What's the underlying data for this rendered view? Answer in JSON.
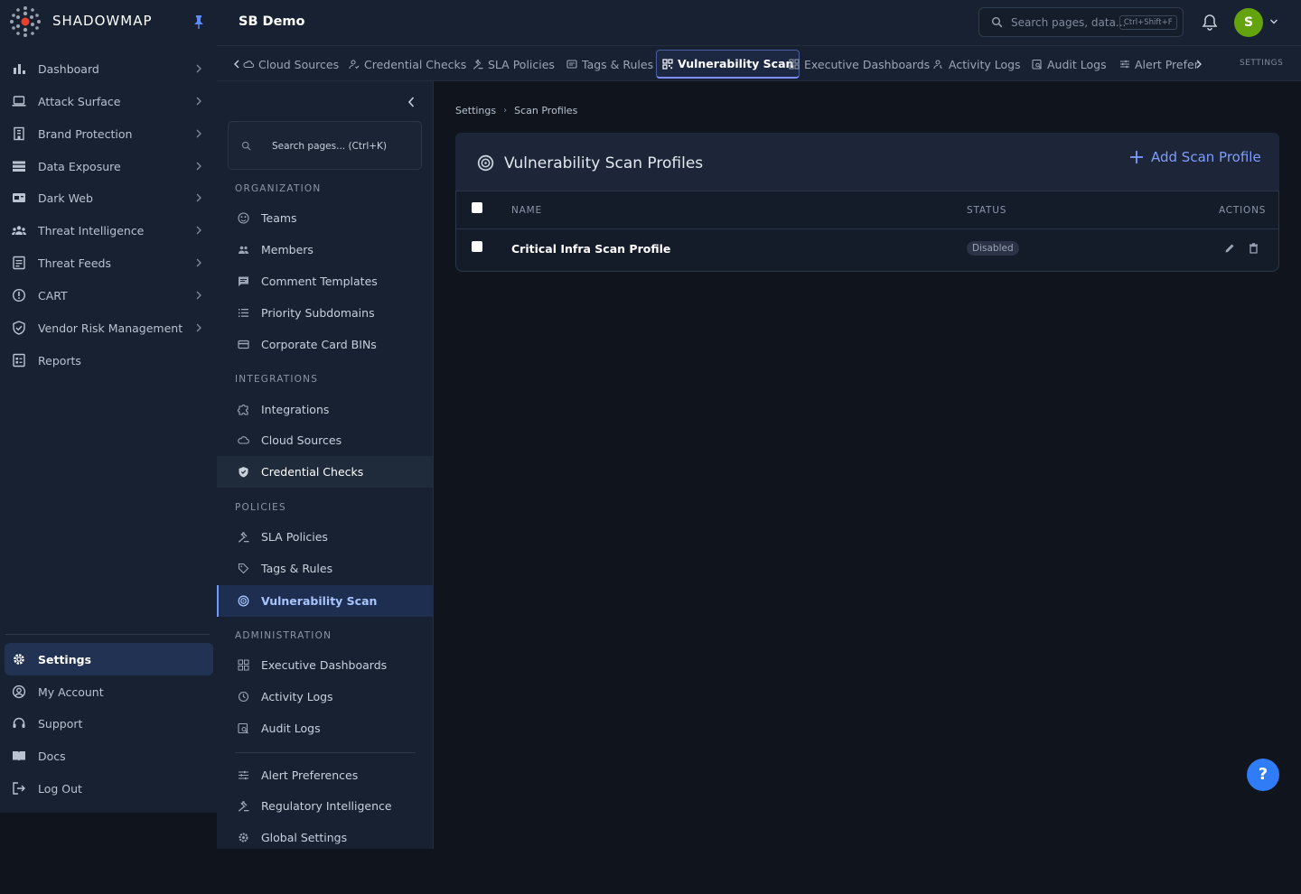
{
  "app": {
    "brand": "SHADOWMAP",
    "page_title": "SB Demo"
  },
  "colors": {
    "accent": "#7f9cff",
    "active_nav": "#223252",
    "avatar": "#64a30d",
    "help": "#2f7cf6",
    "logo_dot": "#e8402b"
  },
  "sidebar": {
    "items": [
      {
        "label": "Dashboard",
        "icon": "bar-chart-icon"
      },
      {
        "label": "Attack Surface",
        "icon": "laptop-icon"
      },
      {
        "label": "Brand Protection",
        "icon": "building-icon"
      },
      {
        "label": "Data Exposure",
        "icon": "database-icon"
      },
      {
        "label": "Dark Web",
        "icon": "dark-web-icon"
      },
      {
        "label": "Threat Intelligence",
        "icon": "people-group-icon"
      },
      {
        "label": "Threat Feeds",
        "icon": "feed-document-icon"
      },
      {
        "label": "CART",
        "icon": "info-circle-icon"
      },
      {
        "label": "Vendor Risk Management",
        "icon": "shield-check-icon"
      },
      {
        "label": "Reports",
        "icon": "report-icon"
      }
    ],
    "bottom": [
      {
        "label": "Settings",
        "icon": "gear-icon"
      },
      {
        "label": "My Account",
        "icon": "user-circle-icon"
      },
      {
        "label": "Support",
        "icon": "headset-icon"
      },
      {
        "label": "Docs",
        "icon": "book-icon"
      },
      {
        "label": "Log Out",
        "icon": "logout-icon"
      }
    ]
  },
  "topbar": {
    "search_placeholder": "Search pages, data...",
    "search_shortcut": "Ctrl+Shift+F",
    "avatar_initial": "S"
  },
  "tabs": {
    "items": [
      "Cloud Sources",
      "Credential Checks",
      "SLA Policies",
      "Tags & Rules",
      "Vulnerability Scan",
      "Executive Dashboards",
      "Activity Logs",
      "Audit Logs",
      "Alert Prefer"
    ],
    "settings_label": "SETTINGS"
  },
  "submenu": {
    "search_placeholder": "Search pages... (Ctrl+K)",
    "sections": {
      "organization": "ORGANIZATION",
      "integrations": "INTEGRATIONS",
      "policies": "POLICIES",
      "administration": "ADMINISTRATION"
    },
    "organization": [
      "Teams",
      "Members",
      "Comment Templates",
      "Priority Subdomains",
      "Corporate Card BINs"
    ],
    "integrations": [
      "Integrations",
      "Cloud Sources",
      "Credential Checks"
    ],
    "policies": [
      "SLA Policies",
      "Tags & Rules",
      "Vulnerability Scan"
    ],
    "administration": [
      "Executive Dashboards",
      "Activity Logs",
      "Audit Logs"
    ],
    "extra": [
      "Alert Preferences",
      "Regulatory Intelligence",
      "Global Settings"
    ]
  },
  "main": {
    "breadcrumb": [
      "Settings",
      "Scan Profiles"
    ],
    "card_title": "Vulnerability Scan Profiles",
    "add_label": "Add Scan Profile",
    "columns": {
      "name": "NAME",
      "status": "STATUS",
      "actions": "ACTIONS"
    },
    "rows": [
      {
        "name": "Critical Infra Scan Profile",
        "status": "Disabled"
      }
    ]
  },
  "help_label": "?"
}
